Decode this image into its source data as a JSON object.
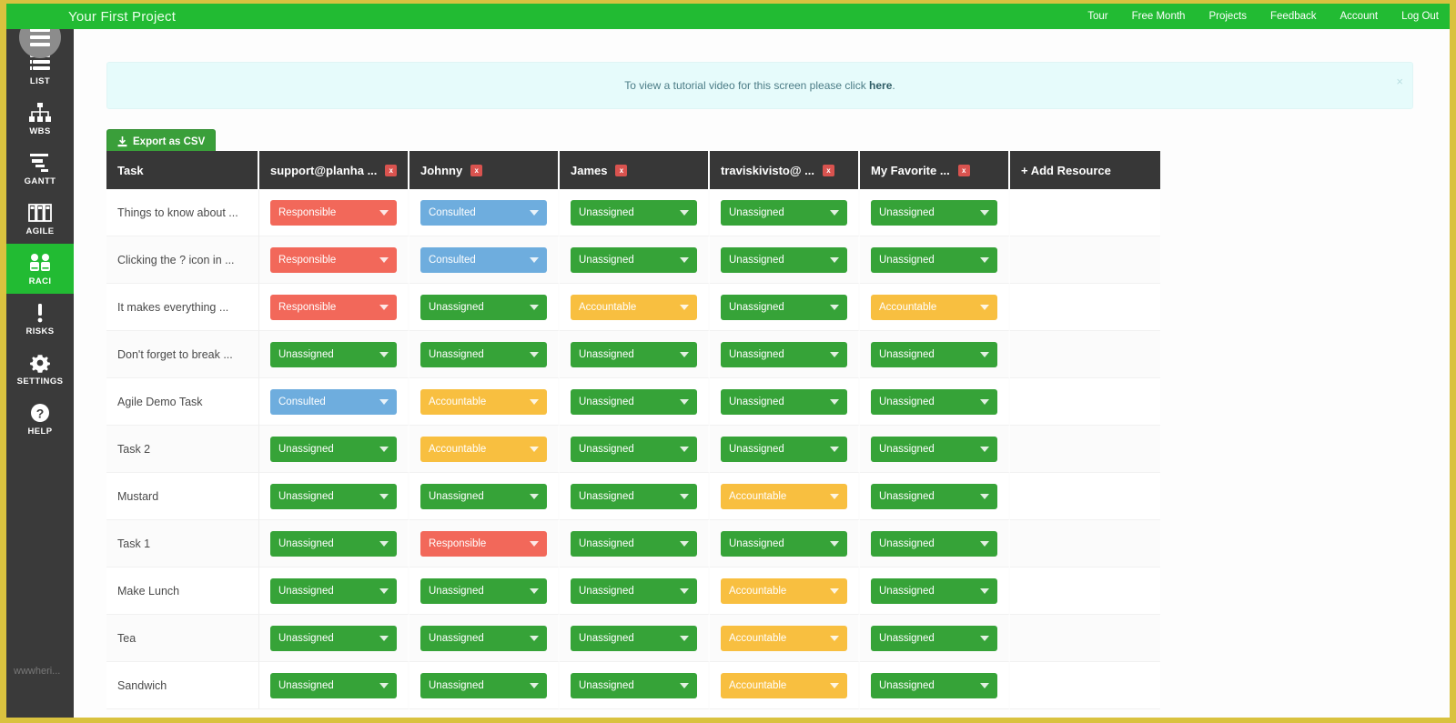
{
  "app": {
    "brand_title": "Your First Project",
    "accent_green": "#22bb33",
    "frame_color": "#d9c23f",
    "watermark": "wwwheri..."
  },
  "topnav": {
    "items": [
      {
        "label": "Tour"
      },
      {
        "label": "Free Month"
      },
      {
        "label": "Projects"
      },
      {
        "label": "Feedback"
      },
      {
        "label": "Account"
      },
      {
        "label": "Log Out"
      }
    ]
  },
  "sidebar": {
    "menu_icon": "hamburger-icon",
    "items": [
      {
        "label": "LIST",
        "icon": "list-icon",
        "active": false
      },
      {
        "label": "WBS",
        "icon": "hierarchy-icon",
        "active": false
      },
      {
        "label": "GANTT",
        "icon": "gantt-icon",
        "active": false
      },
      {
        "label": "AGILE",
        "icon": "kanban-icon",
        "active": false
      },
      {
        "label": "RACI",
        "icon": "people-icon",
        "active": true
      },
      {
        "label": "RISKS",
        "icon": "exclamation-icon",
        "active": false
      },
      {
        "label": "SETTINGS",
        "icon": "gear-icon",
        "active": false
      },
      {
        "label": "HELP",
        "icon": "question-icon",
        "active": false
      }
    ]
  },
  "banner": {
    "text_before": "To view a tutorial video for this screen please click ",
    "link_label": "here",
    "text_after": ".",
    "close_label": "×"
  },
  "toolbar": {
    "export_label": "Export as CSV",
    "export_icon": "download-icon"
  },
  "table": {
    "task_column_header": "Task",
    "add_resource_label": "+ Add Resource",
    "remove_badge_label": "x",
    "resources": [
      {
        "name": "support@planha ..."
      },
      {
        "name": "Johnny"
      },
      {
        "name": "James"
      },
      {
        "name": "traviskivisto@ ..."
      },
      {
        "name": "My Favorite ..."
      }
    ],
    "role_colors": {
      "Unassigned": "#36a338",
      "Responsible": "#f2685a",
      "Consulted": "#6eadde",
      "Accountable": "#f8bf40"
    },
    "rows": [
      {
        "task": "Things to know about ...",
        "roles": [
          "Responsible",
          "Consulted",
          "Unassigned",
          "Unassigned",
          "Unassigned"
        ]
      },
      {
        "task": "Clicking the ? icon in ...",
        "roles": [
          "Responsible",
          "Consulted",
          "Unassigned",
          "Unassigned",
          "Unassigned"
        ]
      },
      {
        "task": "It makes everything ...",
        "roles": [
          "Responsible",
          "Unassigned",
          "Accountable",
          "Unassigned",
          "Accountable"
        ]
      },
      {
        "task": "Don't forget to break ...",
        "roles": [
          "Unassigned",
          "Unassigned",
          "Unassigned",
          "Unassigned",
          "Unassigned"
        ]
      },
      {
        "task": "Agile Demo Task",
        "roles": [
          "Consulted",
          "Accountable",
          "Unassigned",
          "Unassigned",
          "Unassigned"
        ]
      },
      {
        "task": "Task 2",
        "roles": [
          "Unassigned",
          "Accountable",
          "Unassigned",
          "Unassigned",
          "Unassigned"
        ]
      },
      {
        "task": "Mustard",
        "roles": [
          "Unassigned",
          "Unassigned",
          "Unassigned",
          "Accountable",
          "Unassigned"
        ]
      },
      {
        "task": "Task 1",
        "roles": [
          "Unassigned",
          "Responsible",
          "Unassigned",
          "Unassigned",
          "Unassigned"
        ]
      },
      {
        "task": "Make Lunch",
        "roles": [
          "Unassigned",
          "Unassigned",
          "Unassigned",
          "Accountable",
          "Unassigned"
        ]
      },
      {
        "task": "Tea",
        "roles": [
          "Unassigned",
          "Unassigned",
          "Unassigned",
          "Accountable",
          "Unassigned"
        ]
      },
      {
        "task": "Sandwich",
        "roles": [
          "Unassigned",
          "Unassigned",
          "Unassigned",
          "Accountable",
          "Unassigned"
        ]
      }
    ]
  }
}
